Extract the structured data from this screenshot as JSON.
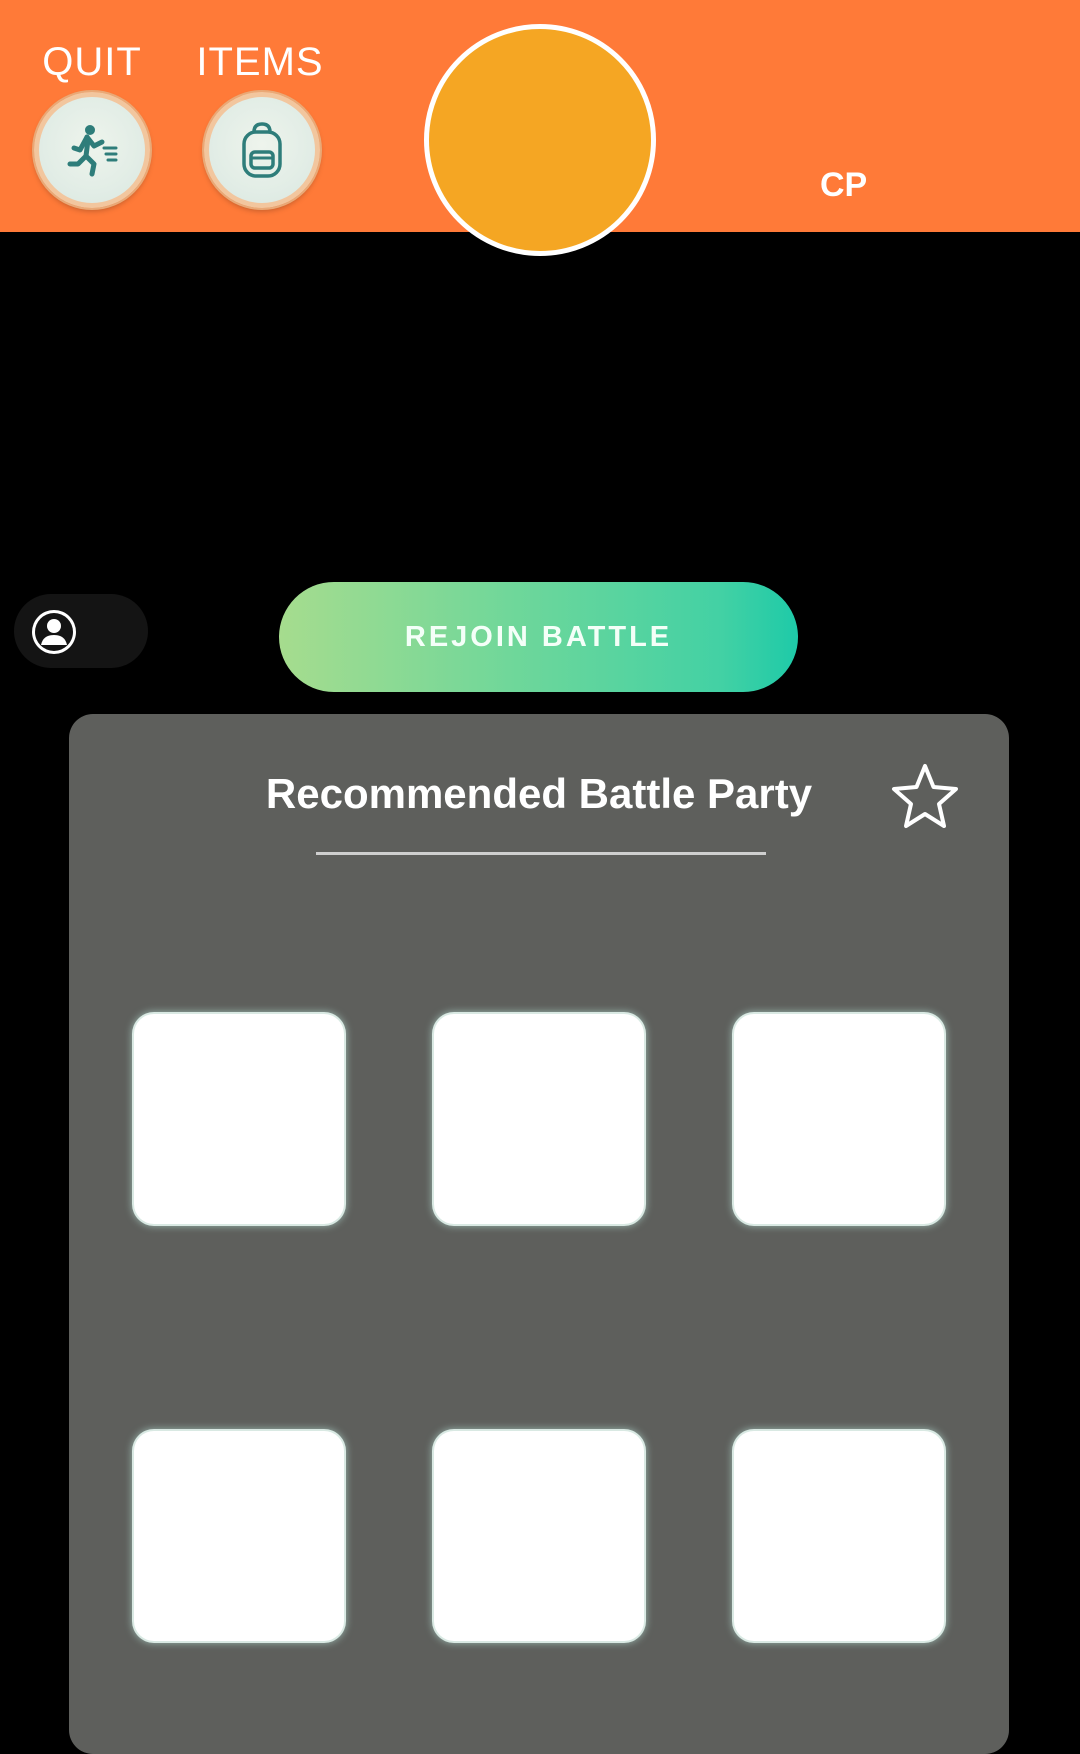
{
  "header": {
    "quit_label": "QUIT",
    "items_label": "ITEMS",
    "cp_label": "CP"
  },
  "actions": {
    "rejoin_label": "REJOIN BATTLE"
  },
  "party_panel": {
    "title": "Recommended Battle Party",
    "slots": 6
  },
  "colors": {
    "header_bg": "#FF7A38",
    "avatar_fill": "#F5A623",
    "panel_bg": "#5E5F5C",
    "rejoin_gradient_start": "#A6DC8E",
    "rejoin_gradient_end": "#1ECAA8"
  },
  "icons": {
    "quit": "running-person-icon",
    "items": "backpack-icon",
    "profile": "profile-icon",
    "favorite": "star-icon"
  }
}
